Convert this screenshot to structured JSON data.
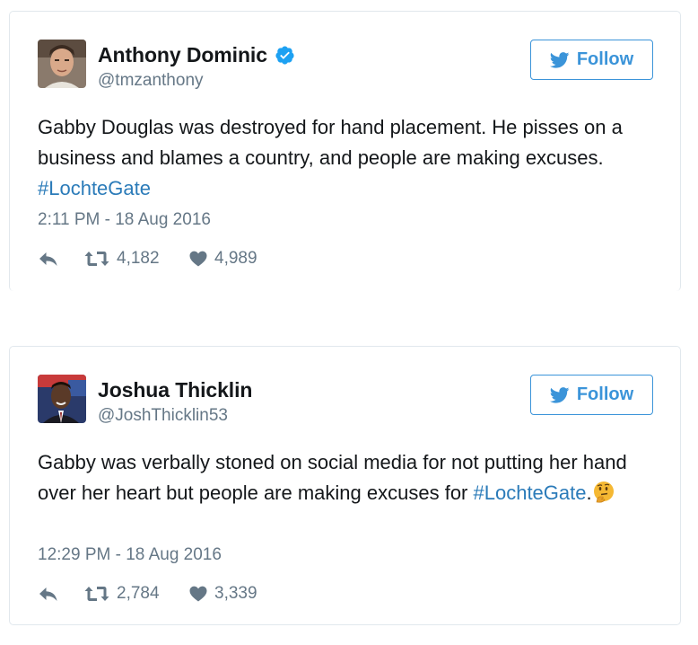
{
  "tweets": [
    {
      "name": "Anthony Dominic",
      "verified": true,
      "handle": "@tmzanthony",
      "follow_label": "Follow",
      "text_main": "Gabby Douglas was destroyed for hand placement. He pisses on a business and blames a country, and people are making excuses. ",
      "hashtag": "#LochteGate",
      "text_after": "",
      "timestamp": "2:11 PM - 18 Aug 2016",
      "retweets": "4,182",
      "likes": "4,989"
    },
    {
      "name": "Joshua Thicklin",
      "verified": false,
      "handle": "@JoshThicklin53",
      "follow_label": "Follow",
      "text_main": "Gabby was verbally stoned on social media for not putting her hand over her heart but people are making excuses for ",
      "hashtag": "#LochteGate",
      "text_after": ".",
      "emoji": "thinking-face-emoji",
      "timestamp": "12:29 PM - 18 Aug 2016",
      "retweets": "2,784",
      "likes": "3,339"
    }
  ],
  "colors": {
    "twitter_blue": "#3b94d9",
    "hashtag": "#2b7bb9",
    "muted": "#657786",
    "text": "#14171a",
    "border": "#e1e8ed"
  },
  "icons": [
    "twitter-bird-icon",
    "verified-badge-icon",
    "reply-icon",
    "retweet-icon",
    "heart-icon"
  ]
}
